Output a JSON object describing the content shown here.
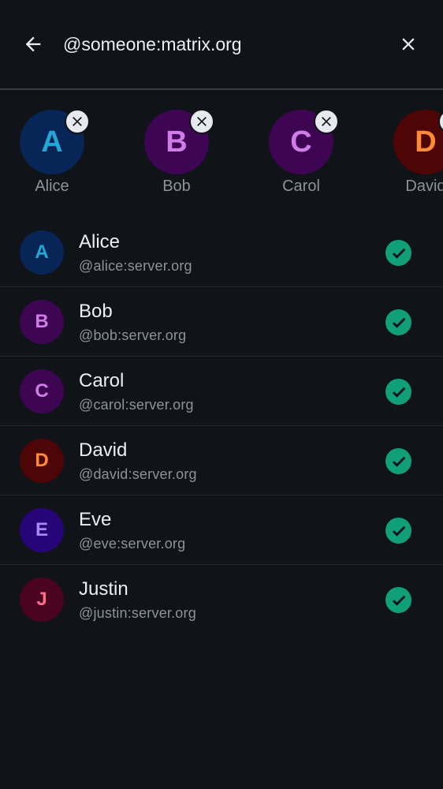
{
  "search": {
    "query": "@someone:matrix.org",
    "placeholder": ""
  },
  "icons": {
    "back": "arrow-left-icon",
    "clear": "close-icon",
    "remove": "close-icon",
    "selected": "checkmark-icon"
  },
  "colors": {
    "background": "#101317",
    "check_green": "#0fa07a"
  },
  "selected_users": [
    {
      "initial": "A",
      "name": "Alice",
      "bg": "#072556",
      "fg": "#22a7d6"
    },
    {
      "initial": "B",
      "name": "Bob",
      "bg": "#3e0553",
      "fg": "#d07ce8"
    },
    {
      "initial": "C",
      "name": "Carol",
      "bg": "#3e0553",
      "fg": "#d07ce8"
    },
    {
      "initial": "D",
      "name": "David",
      "bg": "#4e0505",
      "fg": "#ff8a36"
    }
  ],
  "users": [
    {
      "initial": "A",
      "name": "Alice",
      "id": "@alice:server.org",
      "bg": "#072556",
      "fg": "#22a7d6",
      "selected": true
    },
    {
      "initial": "B",
      "name": "Bob",
      "id": "@bob:server.org",
      "bg": "#3e0553",
      "fg": "#d07ce8",
      "selected": true
    },
    {
      "initial": "C",
      "name": "Carol",
      "id": "@carol:server.org",
      "bg": "#3e0553",
      "fg": "#d07ce8",
      "selected": true
    },
    {
      "initial": "D",
      "name": "David",
      "id": "@david:server.org",
      "bg": "#4e0505",
      "fg": "#ff8a36",
      "selected": true
    },
    {
      "initial": "E",
      "name": "Eve",
      "id": "@eve:server.org",
      "bg": "#260578",
      "fg": "#a48af5",
      "selected": true
    },
    {
      "initial": "J",
      "name": "Justin",
      "id": "@justin:server.org",
      "bg": "#4a0420",
      "fg": "#ff6d8a",
      "selected": true
    }
  ]
}
